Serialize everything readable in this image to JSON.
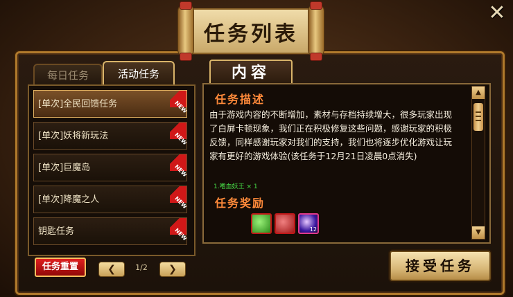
{
  "window": {
    "title": "任务列表",
    "close_icon": "close-icon"
  },
  "tabs": [
    {
      "label": "每日任务",
      "active": false
    },
    {
      "label": "活动任务",
      "active": true
    }
  ],
  "quest_list": [
    {
      "label": "[单次]全民回馈任务",
      "badge": "NEW",
      "selected": true
    },
    {
      "label": "[单次]妖将新玩法",
      "badge": "NEW",
      "selected": false
    },
    {
      "label": "[单次]巨魔岛",
      "badge": "NEW",
      "selected": false
    },
    {
      "label": "[单次]降魔之人",
      "badge": "NEW",
      "selected": false
    },
    {
      "label": "钥匙任务",
      "badge": "NEW",
      "selected": false
    }
  ],
  "footer": {
    "reset_label": "任务重置",
    "prev_glyph": "❮",
    "next_glyph": "❯",
    "page": "1/2"
  },
  "content": {
    "tab_label": "内容",
    "desc_title": "任务描述",
    "description": "由于游戏内容的不断增加，素材与存档持续增大，很多玩家出现了白屏卡顿现象，我们正在积极修复这些问题，感谢玩家的积极反馈，同样感谢玩家对我们的支持，我们也将逐步优化游戏让玩家有更好的游戏体验(该任务于12月21日凌晨0点消失)",
    "reward_requirement": "1.嗜血妖王 × 1",
    "reward_title": "任务奖励",
    "rewards": [
      {
        "icon": "green-gem-icon",
        "count": ""
      },
      {
        "icon": "red-gem-icon",
        "count": ""
      },
      {
        "icon": "purple-orb-icon",
        "count": "12"
      }
    ]
  },
  "accept_label": "接受任务",
  "colors": {
    "accent": "#ff8a3a",
    "reward_green": "#48e048",
    "button_red": "#e02020"
  }
}
